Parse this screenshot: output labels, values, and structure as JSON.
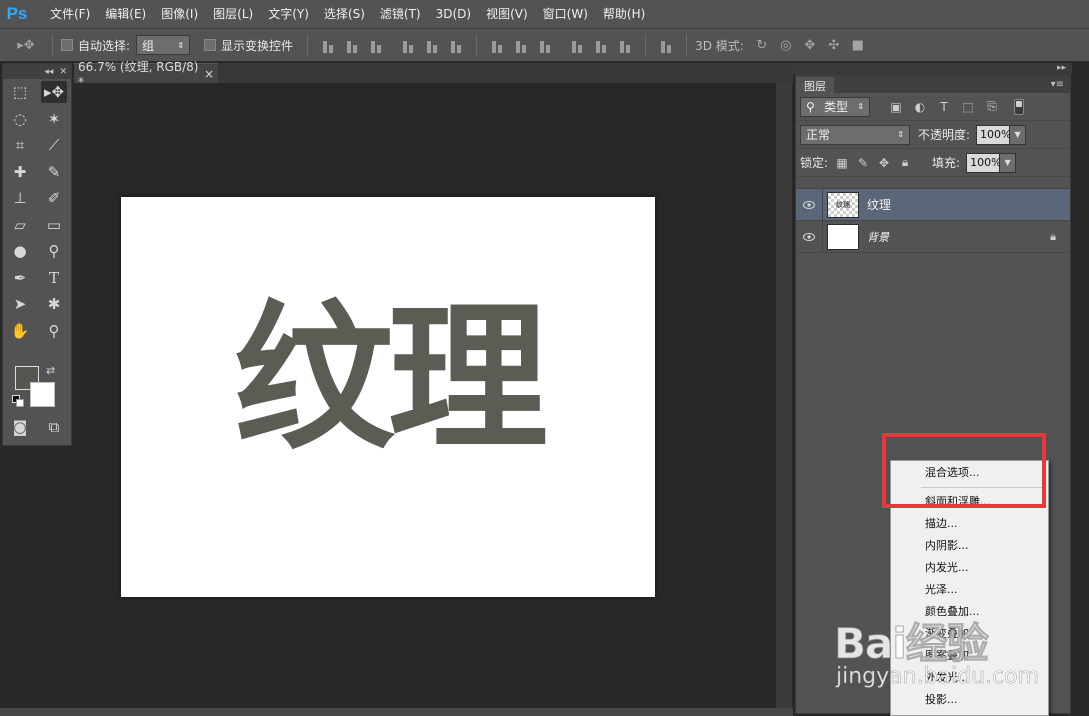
{
  "app": {
    "logo": "Ps",
    "menu": [
      "文件(F)",
      "编辑(E)",
      "图像(I)",
      "图层(L)",
      "文字(Y)",
      "选择(S)",
      "滤镜(T)",
      "3D(D)",
      "视图(V)",
      "窗口(W)",
      "帮助(H)"
    ]
  },
  "options_bar": {
    "auto_select_label": "自动选择:",
    "auto_select_value": "组",
    "show_transform_label": "显示变换控件",
    "mode_3d_label": "3D 模式:"
  },
  "document": {
    "tab_title": "66.7% (纹理, RGB/8) *",
    "tab_close": "×",
    "canvas_text": "纹理"
  },
  "colors": {
    "foreground": "#565651",
    "background": "#ffffff",
    "highlight_border": "#e8383d",
    "selected_layer": "#5a6778"
  },
  "layers_panel": {
    "tab_label": "图层",
    "filter_kind": "类型",
    "blend_mode": "正常",
    "opacity_label": "不透明度:",
    "opacity_value": "100%",
    "lock_label": "锁定:",
    "fill_label": "填充:",
    "fill_value": "100%",
    "layers": [
      {
        "name": "纹理",
        "thumb_text": "纹理",
        "selected": true
      },
      {
        "name": "背景",
        "locked": true
      }
    ]
  },
  "context_menu": {
    "items": [
      "混合选项...",
      "斜面和浮雕...",
      "描边...",
      "内阴影...",
      "内发光...",
      "光泽...",
      "颜色叠加...",
      "渐变叠加...",
      "图案叠加...",
      "外发光...",
      "投影..."
    ]
  },
  "watermark": {
    "brand": "Bai经验",
    "sub": "jingyan.baidu.com"
  }
}
